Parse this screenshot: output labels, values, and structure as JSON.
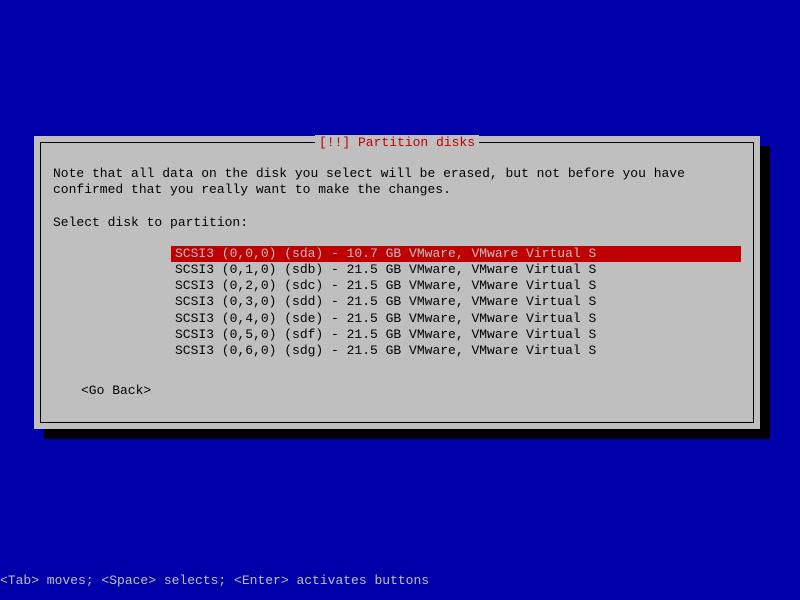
{
  "dialog": {
    "title": "[!!] Partition disks",
    "note": "Note that all data on the disk you select will be erased, but not before you have\nconfirmed that you really want to make the changes.",
    "prompt": "Select disk to partition:",
    "disks": [
      "SCSI3 (0,0,0) (sda) - 10.7 GB VMware, VMware Virtual S",
      "SCSI3 (0,1,0) (sdb) - 21.5 GB VMware, VMware Virtual S",
      "SCSI3 (0,2,0) (sdc) - 21.5 GB VMware, VMware Virtual S",
      "SCSI3 (0,3,0) (sdd) - 21.5 GB VMware, VMware Virtual S",
      "SCSI3 (0,4,0) (sde) - 21.5 GB VMware, VMware Virtual S",
      "SCSI3 (0,5,0) (sdf) - 21.5 GB VMware, VMware Virtual S",
      "SCSI3 (0,6,0) (sdg) - 21.5 GB VMware, VMware Virtual S"
    ],
    "selected_index": 0,
    "go_back": "<Go Back>"
  },
  "help_bar": "<Tab> moves; <Space> selects; <Enter> activates buttons"
}
